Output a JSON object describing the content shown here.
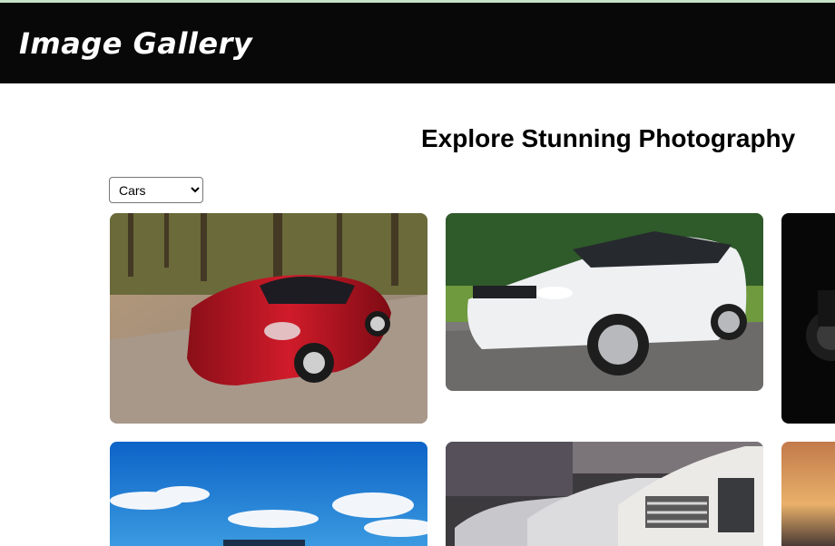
{
  "header": {
    "title": "Image Gallery"
  },
  "main": {
    "heading": "Explore Stunning Photography",
    "category_select": {
      "selected": "Cars"
    }
  },
  "gallery": {
    "images": [
      {
        "subject": "red sports car on forest road"
      },
      {
        "subject": "white SUV on road"
      },
      {
        "subject": "dark car image (partially visible)"
      },
      {
        "subject": "car under blue sky with clouds"
      },
      {
        "subject": "row of silver cars"
      },
      {
        "subject": "sunset scene (partially visible)"
      }
    ]
  },
  "colors": {
    "header_bg": "#080808",
    "top_strip": "#c7e3c7"
  }
}
